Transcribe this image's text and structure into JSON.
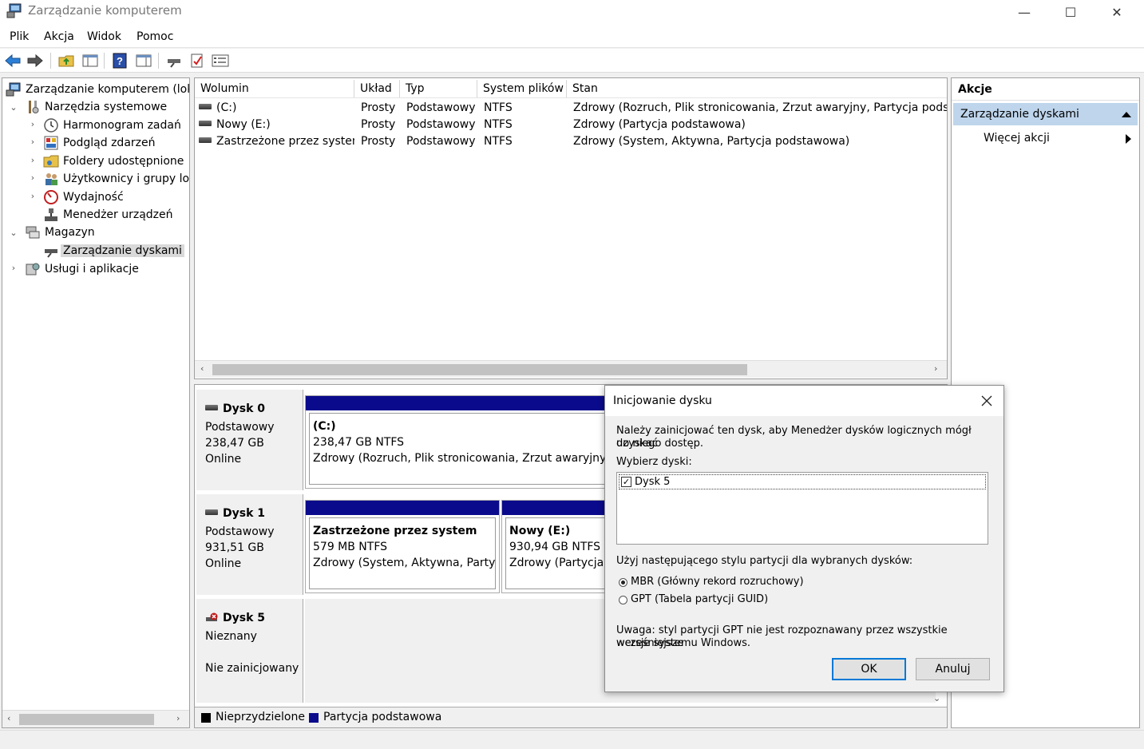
{
  "window": {
    "title": "Zarządzanie komputerem",
    "minimize": "—",
    "maximize": "☐",
    "close": "✕"
  },
  "menu": [
    "Plik",
    "Akcja",
    "Widok",
    "Pomoc"
  ],
  "tree": {
    "root": "Zarządzanie komputerem (lokal",
    "system_tools": "Narzędzia systemowe",
    "task_scheduler": "Harmonogram zadań",
    "event_viewer": "Podgląd zdarzeń",
    "shared_folders": "Foldery udostępnione",
    "users_groups": "Użytkownicy i grupy lok",
    "performance": "Wydajność",
    "device_manager": "Menedżer urządzeń",
    "storage": "Magazyn",
    "disk_management": "Zarządzanie dyskami",
    "services_apps": "Usługi i aplikacje"
  },
  "volumes": {
    "columns": [
      "Wolumin",
      "Układ",
      "Typ",
      "System plików",
      "Stan"
    ],
    "rows": [
      {
        "name": "(C:)",
        "layout": "Prosty",
        "type": "Podstawowy",
        "fs": "NTFS",
        "status": "Zdrowy (Rozruch, Plik stronicowania, Zrzut awaryjny, Partycja podstawc"
      },
      {
        "name": "Nowy (E:)",
        "layout": "Prosty",
        "type": "Podstawowy",
        "fs": "NTFS",
        "status": "Zdrowy (Partycja podstawowa)"
      },
      {
        "name": "Zastrzeżone przez system",
        "layout": "Prosty",
        "type": "Podstawowy",
        "fs": "NTFS",
        "status": "Zdrowy (System, Aktywna, Partycja podstawowa)"
      }
    ]
  },
  "disks": {
    "disk0": {
      "name": "Dysk 0",
      "type": "Podstawowy",
      "size": "238,47 GB",
      "state": "Online",
      "partition": {
        "title": "(C:)",
        "size": "238,47 GB NTFS",
        "status": "Zdrowy (Rozruch, Plik stronicowania, Zrzut awaryjny, Pa"
      }
    },
    "disk1": {
      "name": "Dysk 1",
      "type": "Podstawowy",
      "size": "931,51 GB",
      "state": "Online",
      "partition1": {
        "title": "Zastrzeżone przez system",
        "size": "579 MB NTFS",
        "status": "Zdrowy (System, Aktywna, Partycja"
      },
      "partition2": {
        "title": "Nowy  (E:)",
        "size": "930,94 GB NTFS",
        "status": "Zdrowy (Partycja p"
      }
    },
    "disk5": {
      "name": "Dysk 5",
      "type": "Nieznany",
      "state": "Nie zainicjowany"
    }
  },
  "legend": {
    "unallocated": "Nieprzydzielone",
    "primary": "Partycja podstawowa"
  },
  "colors": {
    "primary_partition": "#0a0a8c",
    "unallocated": "#000000",
    "selection": "#bed5ec",
    "ok_border": "#0078d7"
  },
  "actions": {
    "header": "Akcje",
    "section": "Zarządzanie dyskami",
    "more": "Więcej akcji"
  },
  "dialog": {
    "title": "Inicjowanie dysku",
    "intro_line1": "Należy zainicjować ten dysk, aby Menedżer dysków logicznych mógł uzyskać",
    "intro_line2": "do niego dostęp.",
    "select_label": "Wybierz dyski:",
    "disk_item": "Dysk 5",
    "disk_item_checked": true,
    "style_label": "Użyj następującego stylu partycji dla wybranych dysków:",
    "mbr": "MBR (Główny rekord rozruchowy)",
    "gpt": "GPT (Tabela partycji GUID)",
    "selected_style": "MBR",
    "note_line1": "Uwaga: styl partycji GPT nie jest rozpoznawany przez wszystkie wcześniejsze",
    "note_line2": "wersje systemu Windows.",
    "ok": "OK",
    "cancel": "Anuluj"
  }
}
